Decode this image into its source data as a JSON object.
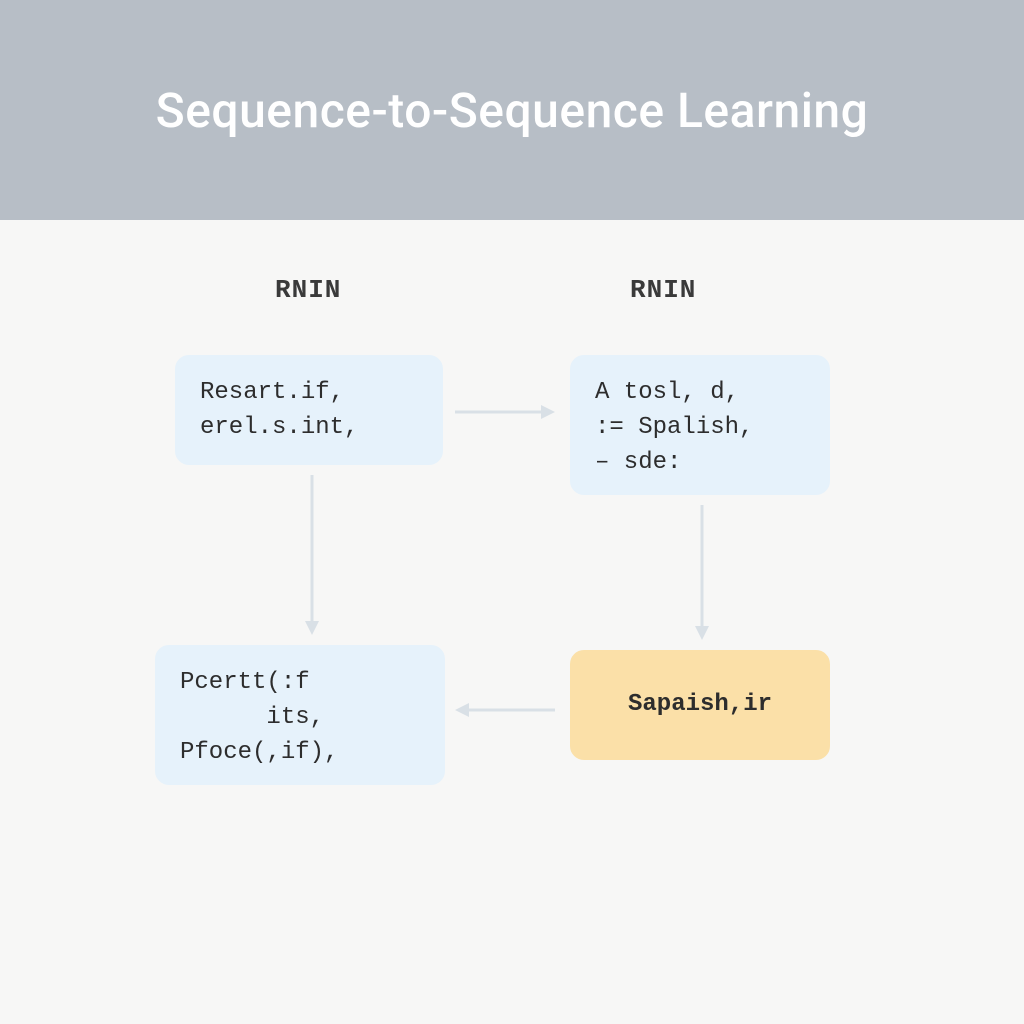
{
  "header": {
    "title": "Sequence-to-Sequence Learning"
  },
  "labels": {
    "left": "RNIN",
    "right": "RNIN"
  },
  "boxes": {
    "top_left": "Resart.if,\nerel.s.int,",
    "top_right": "A tosl, d,\n:= Spalish,\n– sde:",
    "bottom_left": "Pcertt(:f\n      its,\nPfoce(,if),",
    "bottom_right": "Sapaish,ir"
  }
}
